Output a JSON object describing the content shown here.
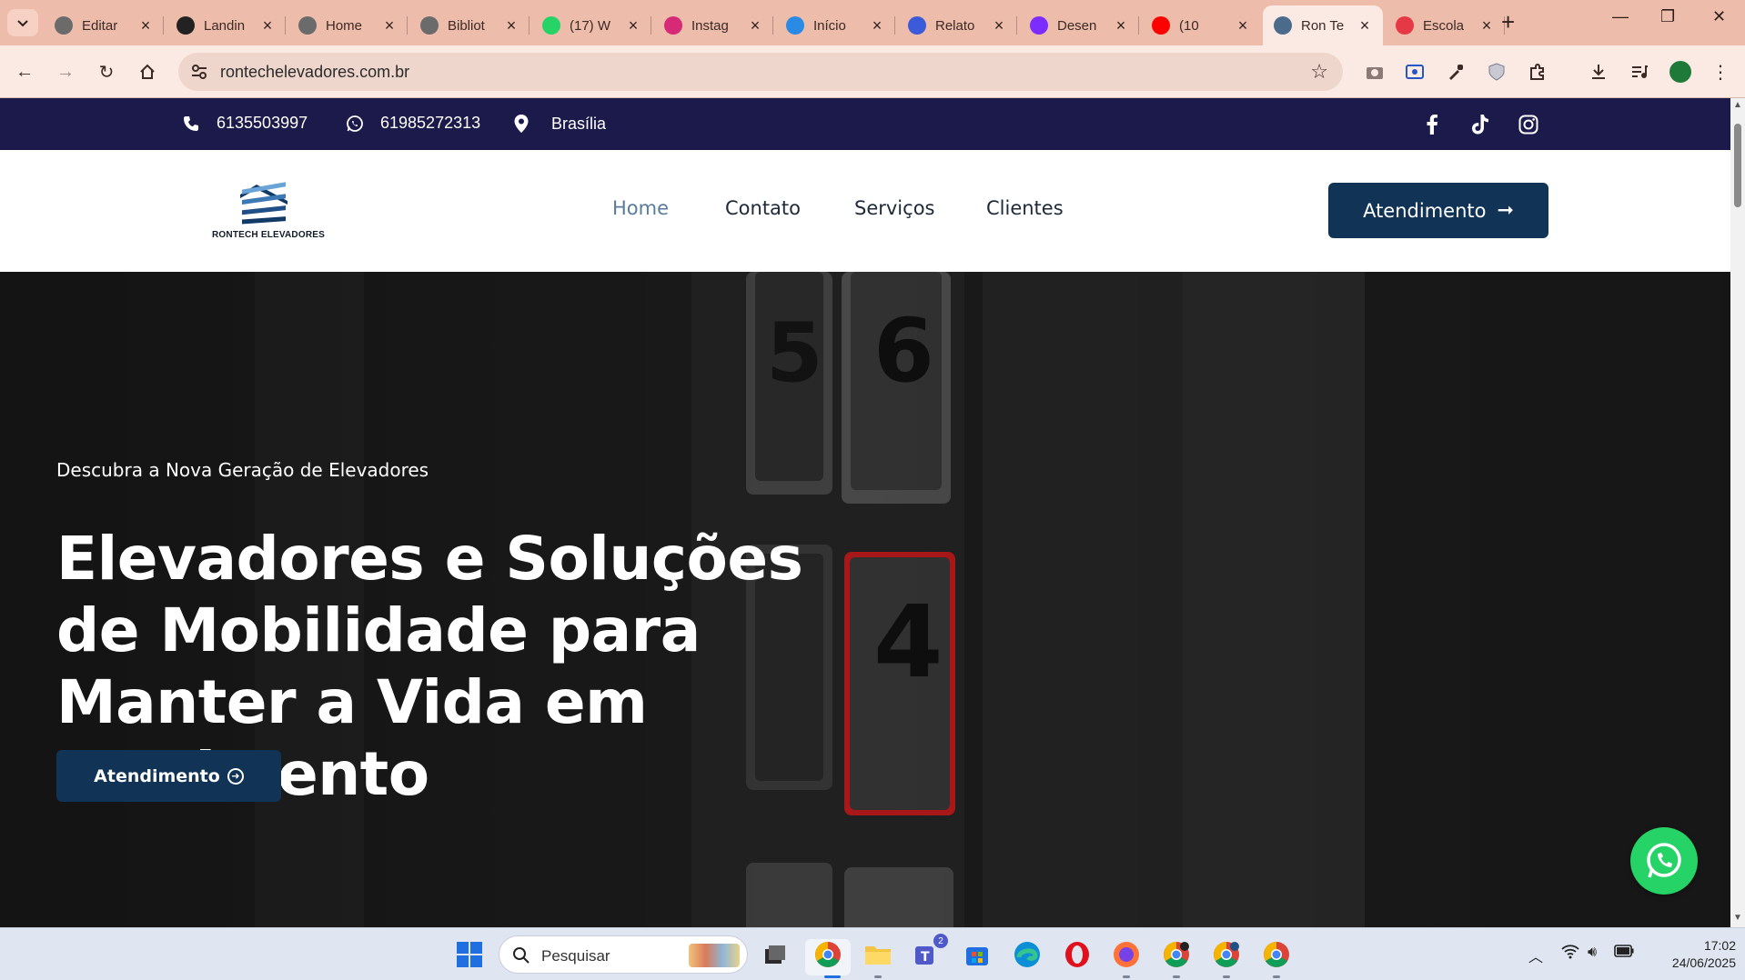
{
  "browser": {
    "tabs": [
      {
        "title": "Editar",
        "icon": "globe-icon",
        "color": "#6b6b6b"
      },
      {
        "title": "Landin",
        "icon": "openai-icon",
        "color": "#222222"
      },
      {
        "title": "Home",
        "icon": "globe-icon",
        "color": "#6b6b6b"
      },
      {
        "title": "Bibliot",
        "icon": "globe-icon",
        "color": "#6b6b6b"
      },
      {
        "title": "(17) W",
        "icon": "whatsapp-icon",
        "color": "#25d366"
      },
      {
        "title": "Instag",
        "icon": "instagram-icon",
        "color": "#d62976"
      },
      {
        "title": "Início",
        "icon": "canva-icon",
        "color": "#2a8be6"
      },
      {
        "title": "Relato",
        "icon": "report-icon",
        "color": "#3b5bdb"
      },
      {
        "title": "Desen",
        "icon": "v-icon",
        "color": "#7b2cff"
      },
      {
        "title": "(10",
        "icon": "youtube-icon",
        "color": "#ff0000"
      },
      {
        "title": "Ron Te",
        "icon": "site-logo-icon",
        "color": "#4a6b8a"
      },
      {
        "title": "Escola",
        "icon": "school-icon",
        "color": "#e63946"
      }
    ],
    "active_tab_index": 10,
    "url": "rontechelevadores.com.br"
  },
  "topbar": {
    "phone": "6135503997",
    "whatsapp": "61985272313",
    "location": "Brasília"
  },
  "nav": {
    "logo_text": "RONTECH ELEVADORES",
    "menu": [
      "Home",
      "Contato",
      "Serviços",
      "Clientes"
    ],
    "current": "Home",
    "cta": "Atendimento",
    "cta_color": "#113355"
  },
  "hero": {
    "subtitle": "Descubra a Nova Geração de Elevadores",
    "title": "Elevadores e Soluções de Mobilidade para Manter a Vida em Movimento",
    "cta": "Atendimento"
  },
  "taskbar": {
    "search_placeholder": "Pesquisar",
    "time": "17:02",
    "date": "24/06/2025",
    "teams_badge": "2"
  },
  "colors": {
    "topbar_bg": "#1b1a4b",
    "accent": "#113355",
    "whatsapp": "#25d366",
    "chrome": "#edbcab"
  }
}
